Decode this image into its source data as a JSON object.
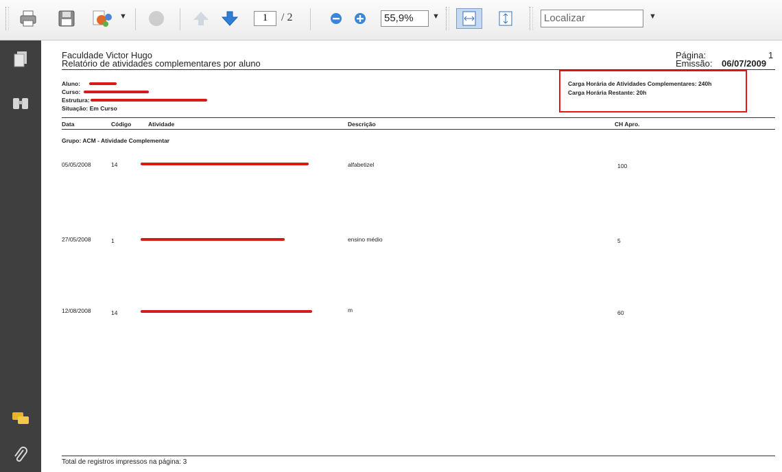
{
  "toolbar": {
    "page_current": "1",
    "page_total": "/ 2",
    "zoom": "55,9%",
    "find_placeholder": "Localizar",
    "icons": [
      "print-icon",
      "save-icon",
      "share-icon",
      "comment-icon",
      "prev-page-icon",
      "next-page-icon",
      "zoom-out-icon",
      "zoom-in-icon",
      "fit-width-icon",
      "fit-page-icon"
    ]
  },
  "leftnav": {
    "icons": [
      "pages-icon",
      "attachments-binoculars-icon",
      "comments-icon",
      "paperclip-icon"
    ]
  },
  "report": {
    "institution": "Faculdade Victor Hugo",
    "title": "Relatório de atividades complementares por aluno",
    "page_label": "Página:",
    "page_value": "1",
    "emission_label": "Emissão:",
    "emission_value": "06/07/2009",
    "student_label": "Aluno:",
    "course_label": "Curso:",
    "structure_label": "Estrutura:",
    "situation": "Situação: Em Curso",
    "hours_total": "Carga Horária de Atividades Complementares: 240h",
    "hours_remaining": "Carga Horária Restante: 20h",
    "columns": {
      "date": "Data",
      "code": "Código",
      "activity": "Atividade",
      "description": "Descrição",
      "hours": "CH Apro."
    },
    "group": "Grupo: ACM - Atividade Complementar",
    "rows": [
      {
        "date": "05/05/2008",
        "code": "14",
        "description": "alfabetizel",
        "hours": "100"
      },
      {
        "date": "27/05/2008",
        "code": "1",
        "description": "ensino médio",
        "hours": "5"
      },
      {
        "date": "12/08/2008",
        "code": "14",
        "description": "m",
        "hours": "60"
      }
    ],
    "footer": "Total de registros impressos na página: 3"
  }
}
